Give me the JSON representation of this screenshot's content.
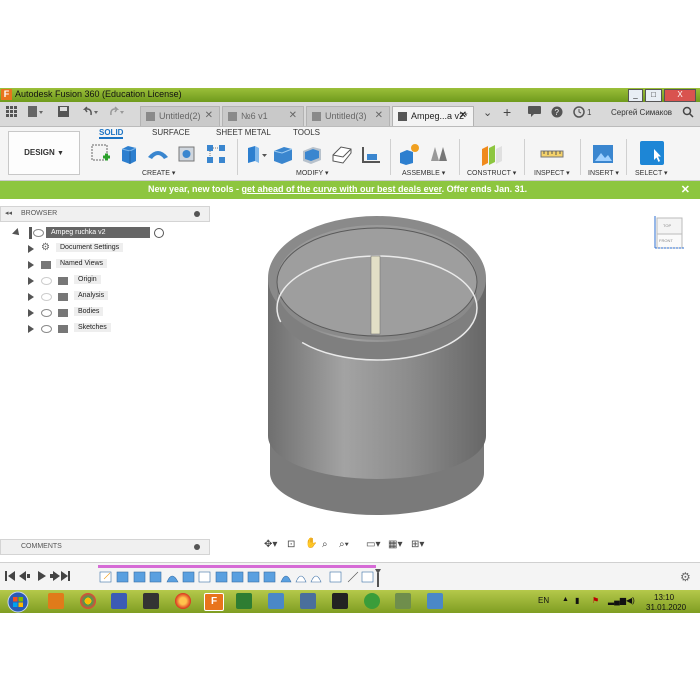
{
  "window": {
    "title": "Autodesk Fusion 360 (Education License)",
    "app_icon": "F",
    "controls": [
      "_",
      "□",
      "X"
    ]
  },
  "tabs": [
    {
      "label": "Untitled(2)",
      "active": false
    },
    {
      "label": "№6 v1",
      "active": false
    },
    {
      "label": "Untitled(3)",
      "active": false
    },
    {
      "label": "Ampeg...a v2*",
      "active": true
    }
  ],
  "header_right": {
    "notification_count": "1",
    "user": "Сергей Симаков"
  },
  "toolbar": {
    "design_button": "DESIGN",
    "workspace_tabs": [
      "SOLID",
      "SURFACE",
      "SHEET METAL",
      "TOOLS"
    ],
    "active_workspace": "SOLID",
    "groups": [
      "CREATE",
      "MODIFY",
      "ASSEMBLE",
      "CONSTRUCT",
      "INSPECT",
      "INSERT",
      "SELECT"
    ]
  },
  "promo": {
    "prefix": "New year, new tools - ",
    "link": "get ahead of the curve with our best deals ever",
    "suffix": ". Offer ends Jan. 31.",
    "close": "✕"
  },
  "browser": {
    "title": "BROWSER",
    "root": "Ampeg ruchka v2",
    "items": [
      "Document Settings",
      "Named Views",
      "Origin",
      "Analysis",
      "Bodies",
      "Sketches"
    ]
  },
  "viewcube": {
    "top": "TOP",
    "front": "FRONT"
  },
  "comments": {
    "title": "COMMENTS"
  },
  "taskbar": {
    "language": "EN",
    "time": "13:10",
    "date": "31.01.2020"
  },
  "icons": [
    "collapse-icon",
    "pin-icon",
    "eye-icon",
    "gear-icon",
    "folder-icon",
    "record-icon",
    "settings-icon",
    "windows-start-icon"
  ],
  "colors": {
    "titlebar": "#7fa524",
    "promo": "#8dc63f",
    "accent": "#1a73c4",
    "model": "#8f8f8f"
  }
}
